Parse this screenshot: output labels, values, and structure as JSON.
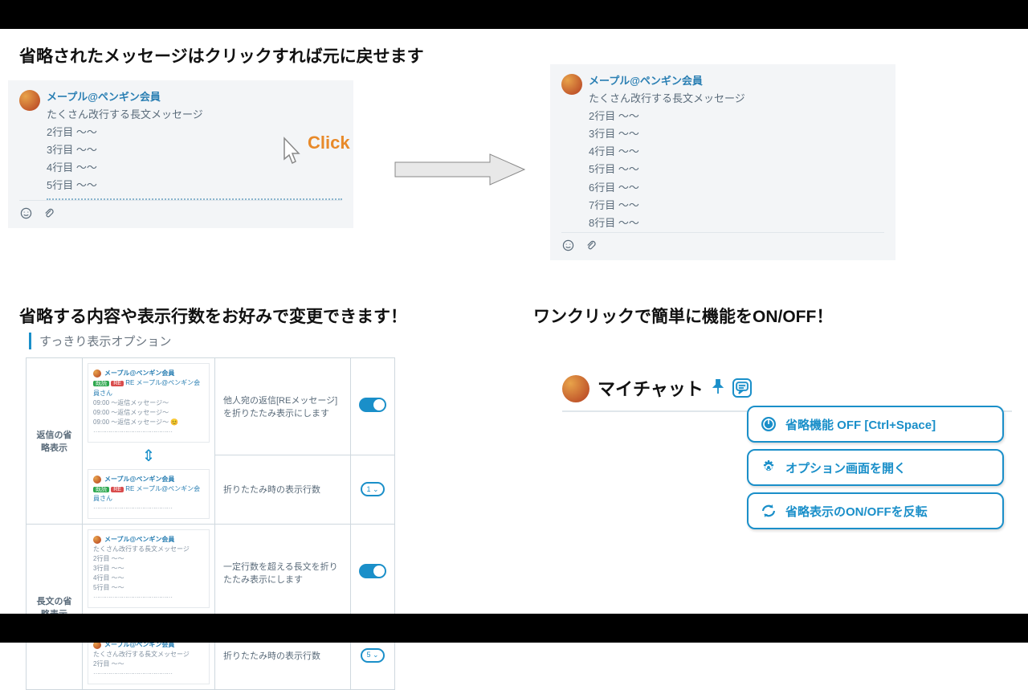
{
  "heading1": "省略されたメッセージはクリックすれば元に戻せます",
  "heading2": "省略する内容や表示行数をお好みで変更できます！",
  "heading3": "ワンクリックで簡単に機能をON/OFF！",
  "click_label": "Click",
  "message": {
    "user": "メープル@ペンギン会員",
    "text": "たくさん改行する長文メッセージ",
    "lines_collapsed": [
      "2行目   ～～",
      "3行目   ～～",
      "4行目   ～～",
      "5行目   ～～"
    ],
    "lines_expanded": [
      "2行目   ～～",
      "3行目   ～～",
      "4行目   ～～",
      "5行目   ～～",
      "6行目   ～～",
      "7行目   ～～",
      "8行目   ～～"
    ]
  },
  "settings": {
    "panel_title": "すっきり表示オプション",
    "row1_label": "返信の省略表示",
    "row2_label": "長文の省略表示",
    "opt1": "他人宛の返信[REメッセージ]を折りたたみ表示にします",
    "opt2": "折りたたみ時の表示行数",
    "opt3": "一定行数を超える長文を折りたたみ表示にします",
    "opt4": "折りたたみ時の表示行数",
    "stepper1": "1 ⌄",
    "stepper2": "5 ⌄",
    "mini_user": "メープル@ペンギン会員",
    "mini_sub": "RE メープル@ペンギン会員さん",
    "mini_cat": "～返信メッセージ～",
    "mini_long": "たくさん改行する長文メッセージ"
  },
  "mychat": {
    "title": "マイチャット",
    "item1": "省略機能 OFF [Ctrl+Space]",
    "item2": "オプション画面を開く",
    "item3": "省略表示のON/OFFを反転"
  }
}
